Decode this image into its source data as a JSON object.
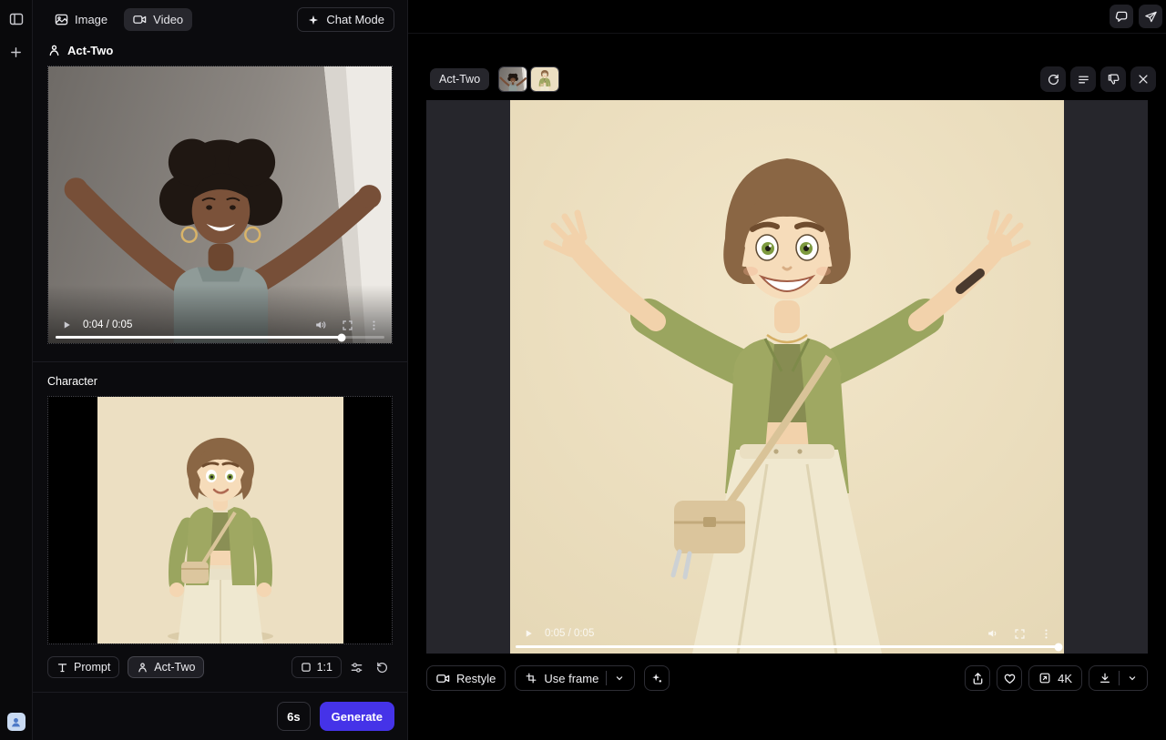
{
  "colors": {
    "accent": "#4533e8",
    "panel_bg": "#0b0b0e",
    "stage_bg": "#26262c",
    "cream": "#ecdfc2"
  },
  "left": {
    "tabs": {
      "image": "Image",
      "video": "Video"
    },
    "chat_mode": "Chat Mode",
    "section_title": "Act-Two",
    "driver_player": {
      "time": "0:04 / 0:05"
    },
    "character_label": "Character",
    "controls": {
      "prompt": "Prompt",
      "act_two": "Act-Two",
      "aspect_ratio": "1:1"
    },
    "footer": {
      "duration": "6s",
      "generate": "Generate"
    }
  },
  "right": {
    "badge": "Act-Two",
    "player": {
      "time": "0:05 / 0:05"
    },
    "toolbar": {
      "restyle": "Restyle",
      "use_frame": "Use frame",
      "quality": "4K"
    }
  }
}
